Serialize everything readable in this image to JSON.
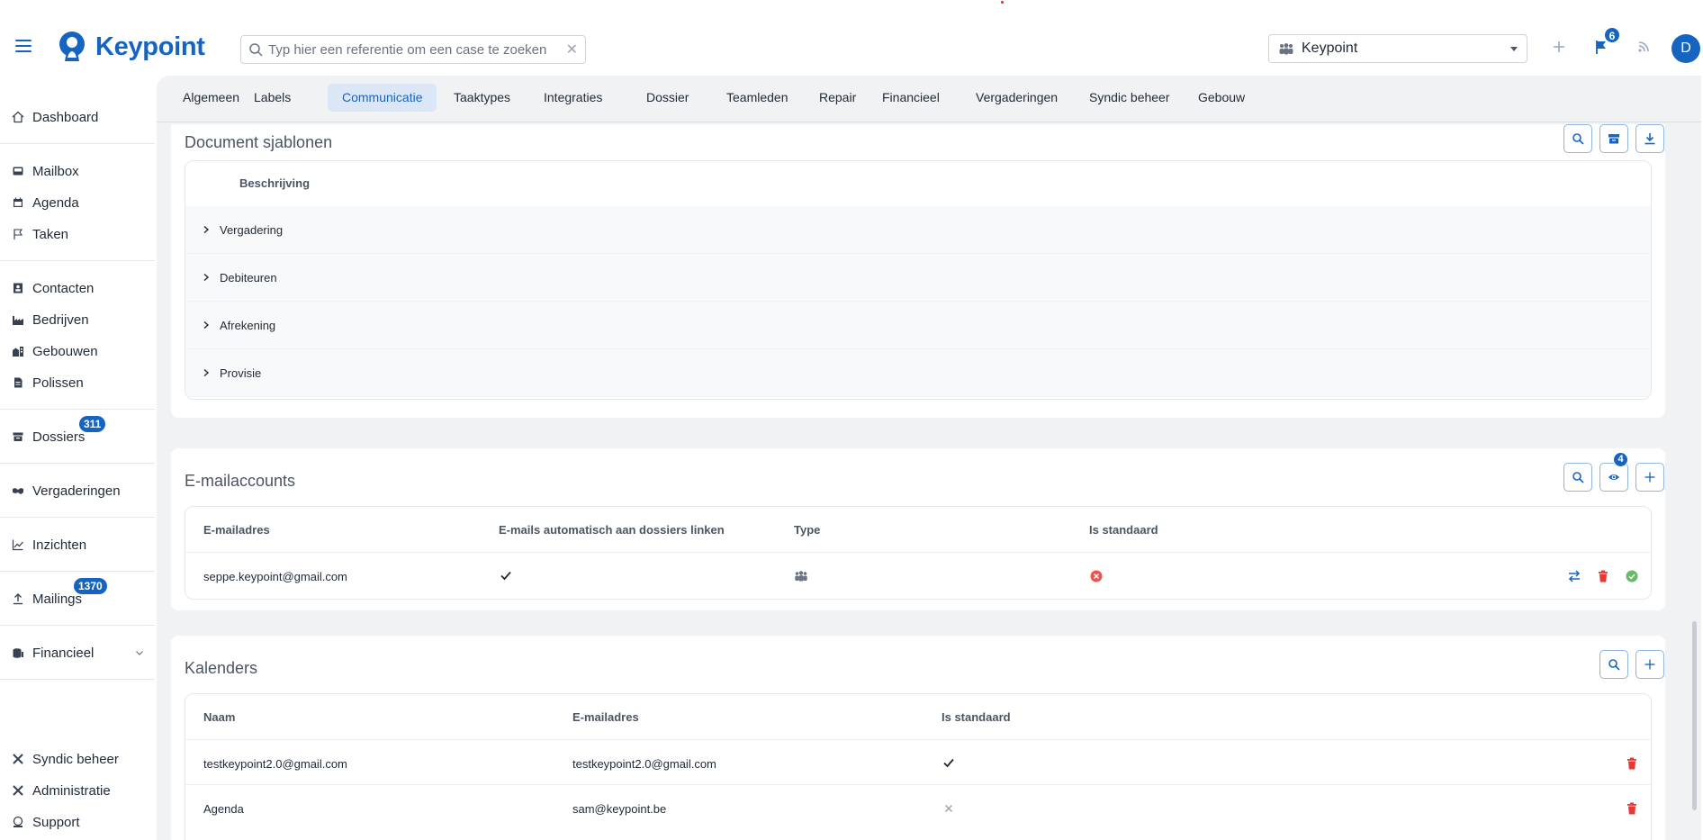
{
  "app": {
    "name": "Keypoint"
  },
  "search": {
    "placeholder": "Typ hier een referentie om een case te zoeken"
  },
  "tenant": {
    "selected": "Keypoint"
  },
  "header": {
    "notification_count": "6",
    "avatar_initial": "D"
  },
  "sidebar": {
    "items": [
      {
        "label": "Dashboard",
        "icon": "home-icon"
      },
      {
        "label": "Mailbox",
        "icon": "inbox-icon"
      },
      {
        "label": "Agenda",
        "icon": "calendar-icon"
      },
      {
        "label": "Taken",
        "icon": "flag-icon"
      },
      {
        "label": "Contacten",
        "icon": "contact-card-icon"
      },
      {
        "label": "Bedrijven",
        "icon": "factory-icon"
      },
      {
        "label": "Gebouwen",
        "icon": "buildings-icon"
      },
      {
        "label": "Polissen",
        "icon": "document-icon"
      },
      {
        "label": "Dossiers",
        "icon": "archive-icon",
        "badge": "311"
      },
      {
        "label": "Vergaderingen",
        "icon": "handshake-icon"
      },
      {
        "label": "Inzichten",
        "icon": "line-chart-icon"
      },
      {
        "label": "Mailings",
        "icon": "upload-icon",
        "badge": "1370"
      },
      {
        "label": "Financieel",
        "icon": "coins-icon"
      },
      {
        "label": "Syndic beheer",
        "icon": "tools-icon"
      },
      {
        "label": "Administratie",
        "icon": "tools-icon"
      },
      {
        "label": "Support",
        "icon": "support-icon"
      }
    ]
  },
  "tabs": [
    {
      "label": "Algemeen"
    },
    {
      "label": "Labels"
    },
    {
      "label": "Communicatie"
    },
    {
      "label": "Taaktypes"
    },
    {
      "label": "Integraties"
    },
    {
      "label": "Dossier"
    },
    {
      "label": "Teamleden"
    },
    {
      "label": "Repair"
    },
    {
      "label": "Financieel"
    },
    {
      "label": "Vergaderingen"
    },
    {
      "label": "Syndic beheer"
    },
    {
      "label": "Gebouw"
    }
  ],
  "document_templates": {
    "title": "Document sjablonen",
    "header": "Beschrijving",
    "groups": [
      "Vergadering",
      "Debiteuren",
      "Afrekening",
      "Provisie"
    ]
  },
  "email_accounts": {
    "title": "E-mailaccounts",
    "hidden_count": "4",
    "columns": [
      "E-mailadres",
      "E-mails automatisch aan dossiers linken",
      "Type",
      "Is standaard"
    ],
    "rows": [
      {
        "email": "seppe.keypoint@gmail.com",
        "auto_link": true,
        "type": "team",
        "is_default": false
      }
    ]
  },
  "calendars": {
    "title": "Kalenders",
    "columns": [
      "Naam",
      "E-mailadres",
      "Is standaard"
    ],
    "rows": [
      {
        "name": "testkeypoint2.0@gmail.com",
        "email": "testkeypoint2.0@gmail.com",
        "is_default": true
      },
      {
        "name": "Agenda",
        "email": "sam@keypoint.be",
        "is_default": false
      }
    ]
  },
  "colors": {
    "primary": "#1565c0",
    "danger": "#e53935",
    "success": "#66bb6a",
    "tab_active_bg": "#dbe7f7"
  }
}
